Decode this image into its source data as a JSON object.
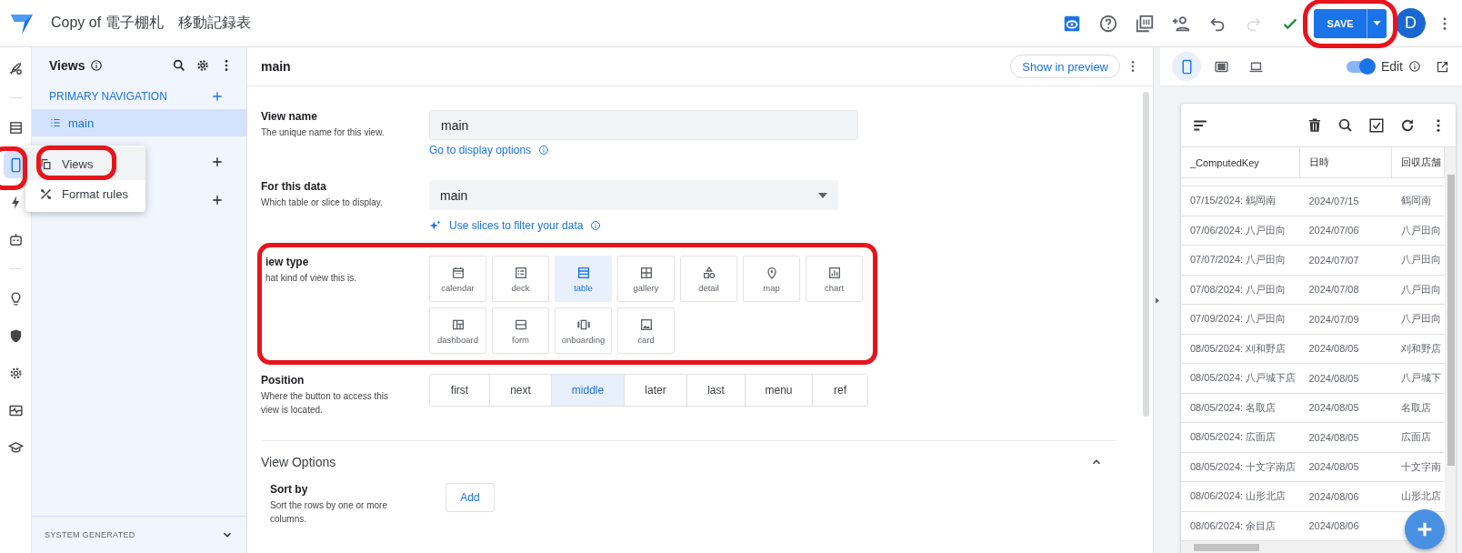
{
  "app_bar": {
    "title": "Copy of 電子棚札　移動記録表",
    "save_label": "SAVE",
    "avatar": "D",
    "preview_on": true,
    "tools": [
      {
        "kind": "help",
        "disabled": false
      },
      {
        "kind": "grid",
        "disabled": false
      },
      {
        "kind": "share",
        "disabled": false
      },
      {
        "kind": "undo",
        "disabled": false
      },
      {
        "kind": "redo",
        "disabled": true
      },
      {
        "kind": "check",
        "disabled": false
      }
    ]
  },
  "rail": [
    {
      "kind": "rocket",
      "selected": false
    },
    {
      "kind": "table",
      "selected": false
    },
    {
      "kind": "phone",
      "selected": true
    },
    {
      "kind": "bolt",
      "selected": false
    },
    {
      "kind": "robot",
      "selected": false
    },
    {
      "kind": "bulb",
      "selected": false
    },
    {
      "kind": "shield",
      "selected": false
    },
    {
      "kind": "gear",
      "selected": false
    },
    {
      "kind": "monitor",
      "selected": false
    },
    {
      "kind": "cap",
      "selected": false
    }
  ],
  "nav_panel": {
    "title": "Views",
    "section": "PRIMARY NAVIGATION",
    "items": [
      {
        "label": "main",
        "selected": true
      }
    ],
    "footer": "SYSTEM GENERATED"
  },
  "popup_menu": [
    {
      "kind": "views",
      "label": "Views"
    },
    {
      "kind": "format",
      "label": "Format rules"
    }
  ],
  "editor": {
    "title": "main",
    "preview_button": "Show in preview",
    "view_name": {
      "label": "View name",
      "hint": "The unique name for this view.",
      "value": "main",
      "link": "Go to display options"
    },
    "data": {
      "label": "For this data",
      "hint": "Which table or slice to display.",
      "value": "main",
      "link": "Use slices to filter your data"
    },
    "view_type": {
      "label": "iew type",
      "hint": "hat kind of view this is.",
      "options": [
        {
          "kind": "calendar",
          "label": "calendar",
          "selected": false
        },
        {
          "kind": "deck",
          "label": "deck",
          "selected": false
        },
        {
          "kind": "table",
          "label": "table",
          "selected": true
        },
        {
          "kind": "gallery",
          "label": "gallery",
          "selected": false
        },
        {
          "kind": "detail",
          "label": "detail",
          "selected": false
        },
        {
          "kind": "map",
          "label": "map",
          "selected": false
        },
        {
          "kind": "chart",
          "label": "chart",
          "selected": false
        },
        {
          "kind": "dashboard",
          "label": "dashboard",
          "selected": false
        },
        {
          "kind": "form",
          "label": "form",
          "selected": false
        },
        {
          "kind": "onboarding",
          "label": "onboarding",
          "selected": false
        },
        {
          "kind": "card",
          "label": "card",
          "selected": false
        }
      ]
    },
    "position": {
      "label": "Position",
      "hint": "Where the button to access this view is located.",
      "options": [
        {
          "label": "first",
          "selected": false
        },
        {
          "label": "next",
          "selected": false
        },
        {
          "label": "middle",
          "selected": true
        },
        {
          "label": "later",
          "selected": false
        },
        {
          "label": "last",
          "selected": false
        },
        {
          "label": "menu",
          "selected": false
        },
        {
          "label": "ref",
          "selected": false
        }
      ]
    },
    "options_section": {
      "title": "View Options",
      "expanded": true
    },
    "sort_by": {
      "label": "Sort by",
      "hint": "Sort the rows by one or more columns.",
      "button": "Add"
    }
  },
  "preview": {
    "devices": [
      {
        "kind": "phone",
        "selected": true
      },
      {
        "kind": "tablet",
        "selected": false
      },
      {
        "kind": "desktop",
        "selected": false
      }
    ],
    "edit": {
      "label": "Edit",
      "on": true
    },
    "table": {
      "columns": [
        "_ComputedKey",
        "日時",
        "回収店舗"
      ],
      "rows": [
        [
          "07/15/2024: 鶴岡南",
          "2024/07/15",
          "鶴岡南"
        ],
        [
          "07/06/2024: 八戸田向",
          "2024/07/06",
          "八戸田向"
        ],
        [
          "07/07/2024: 八戸田向",
          "2024/07/07",
          "八戸田向"
        ],
        [
          "07/08/2024: 八戸田向",
          "2024/07/08",
          "八戸田向"
        ],
        [
          "07/09/2024: 八戸田向",
          "2024/07/09",
          "八戸田向"
        ],
        [
          "08/05/2024: 刈和野店",
          "2024/08/05",
          "刈和野店"
        ],
        [
          "08/05/2024: 八戸城下店",
          "2024/08/05",
          "八戸城下"
        ],
        [
          "08/05/2024: 名取店",
          "2024/08/05",
          "名取店"
        ],
        [
          "08/05/2024: 広面店",
          "2024/08/05",
          "広面店"
        ],
        [
          "08/05/2024: 十文字南店",
          "2024/08/05",
          "十文字南"
        ],
        [
          "08/06/2024: 山形北店",
          "2024/08/06",
          "山形北店"
        ],
        [
          "08/06/2024: 余目店",
          "2024/08/06"
        ]
      ]
    }
  }
}
